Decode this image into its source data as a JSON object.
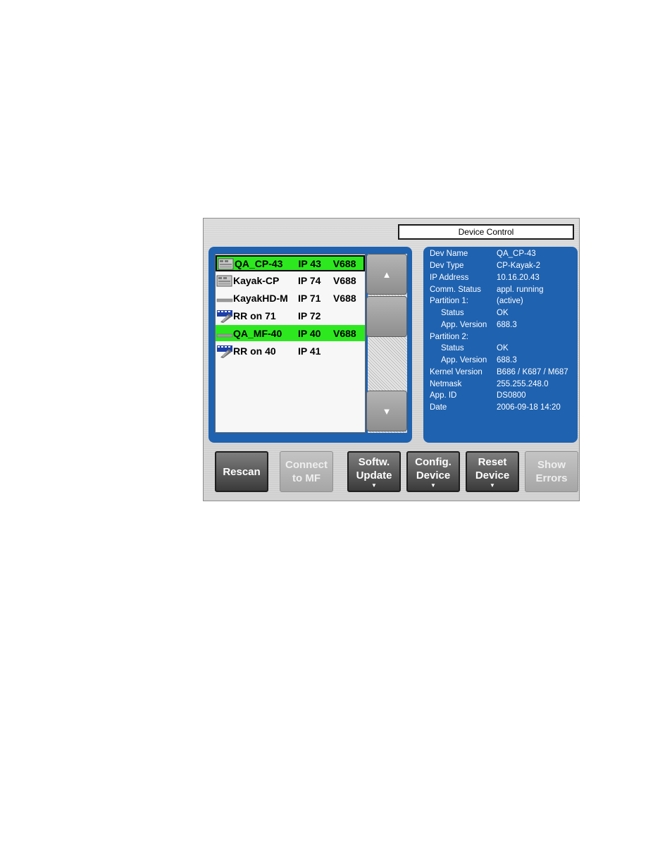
{
  "window": {
    "title": "Device Control"
  },
  "devices": [
    {
      "name": "QA_CP-43",
      "ip": "IP 43",
      "version": "V688",
      "icon": "control-panel-icon",
      "selected": true
    },
    {
      "name": "Kayak-CP",
      "ip": "IP 74",
      "version": "V688",
      "icon": "control-panel-icon",
      "selected": false
    },
    {
      "name": "KayakHD-M",
      "ip": "IP 71",
      "version": "V688",
      "icon": "mainframe-icon",
      "selected": false
    },
    {
      "name": "RR on 71",
      "ip": "IP 72",
      "version": "",
      "icon": "remote-router-icon",
      "selected": false
    },
    {
      "name": "QA_MF-40",
      "ip": "IP 40",
      "version": "V688",
      "icon": "mainframe-icon",
      "selected": true
    },
    {
      "name": "RR on 40",
      "ip": "IP 41",
      "version": "",
      "icon": "remote-router-icon",
      "selected": false
    }
  ],
  "details": [
    {
      "label": "Dev Name",
      "value": "QA_CP-43"
    },
    {
      "label": "Dev Type",
      "value": "CP-Kayak-2"
    },
    {
      "label": "IP Address",
      "value": "10.16.20.43"
    },
    {
      "label": "Comm. Status",
      "value": "appl. running"
    },
    {
      "label": "Partition 1:",
      "value": "(active)"
    },
    {
      "label": "Status",
      "value": "OK"
    },
    {
      "label": "App. Version",
      "value": "688.3"
    },
    {
      "label": "Partition 2:",
      "value": ""
    },
    {
      "label": "Status",
      "value": "OK"
    },
    {
      "label": "App. Version",
      "value": "688.3"
    },
    {
      "label": "Kernel Version",
      "value": "B686 / K687 / M687"
    },
    {
      "label": "Netmask",
      "value": "255.255.248.0"
    },
    {
      "label": "App. ID",
      "value": "DS0800"
    },
    {
      "label": "Date",
      "value": "2006-09-18  14:20"
    }
  ],
  "buttons": {
    "rescan": {
      "line1": "Rescan",
      "line2": ""
    },
    "connect": {
      "line1": "Connect",
      "line2": "to MF"
    },
    "softw": {
      "line1": "Softw.",
      "line2": "Update"
    },
    "config": {
      "line1": "Config.",
      "line2": "Device"
    },
    "reset": {
      "line1": "Reset",
      "line2": "Device"
    },
    "errors": {
      "line1": "Show",
      "line2": "Errors"
    }
  },
  "colors": {
    "panel": "#1f62b0",
    "selected_row": "#2de81f"
  }
}
